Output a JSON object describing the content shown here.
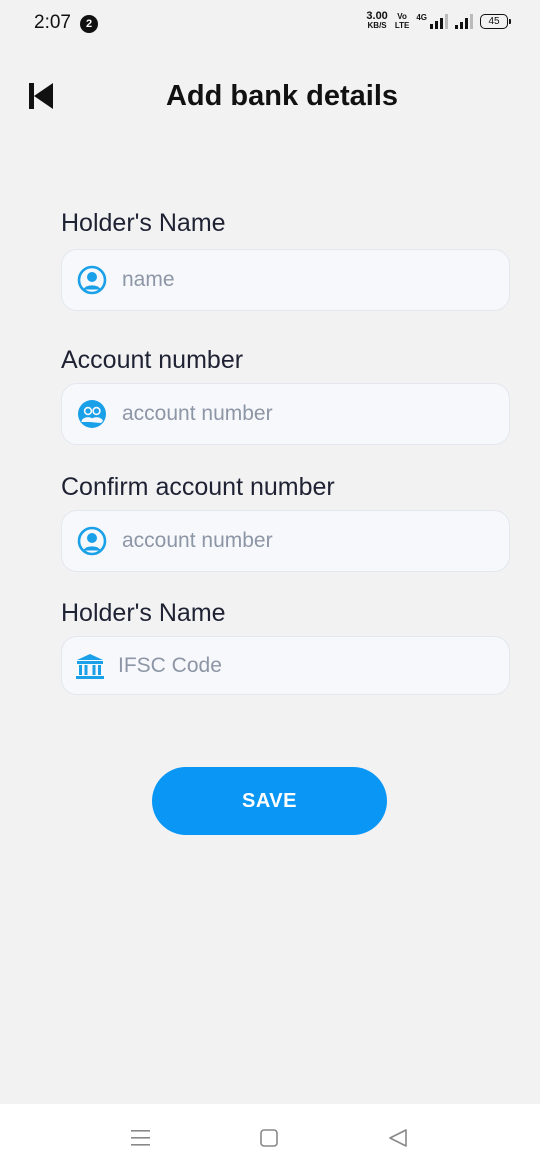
{
  "status_bar": {
    "time": "2:07",
    "notification_count": "2",
    "net_speed_value": "3.00",
    "net_speed_unit": "KB/S",
    "volte_top": "Vo",
    "volte_bottom": "LTE",
    "network_type": "4G",
    "battery_level": "45"
  },
  "header": {
    "title": "Add bank details",
    "back_icon": "skip-back-icon"
  },
  "form": {
    "fields": [
      {
        "label": "Holder's Name",
        "placeholder": "name",
        "value": "",
        "icon": "user-circle-icon"
      },
      {
        "label": "Account number",
        "placeholder": "account number",
        "value": "",
        "icon": "users-circle-icon"
      },
      {
        "label": "Confirm account number",
        "placeholder": "account number",
        "value": "",
        "icon": "user-circle-icon"
      },
      {
        "label": "Holder's Name",
        "placeholder": "IFSC Code",
        "value": "",
        "icon": "bank-icon"
      }
    ],
    "save_label": "SAVE"
  },
  "colors": {
    "accent": "#0a96f5",
    "icon": "#1aa0e8",
    "background": "#f2f2f3",
    "field_background": "#f7f8fb"
  },
  "nav_bar": {
    "items": [
      "menu-icon",
      "home-square-icon",
      "back-triangle-icon"
    ]
  }
}
